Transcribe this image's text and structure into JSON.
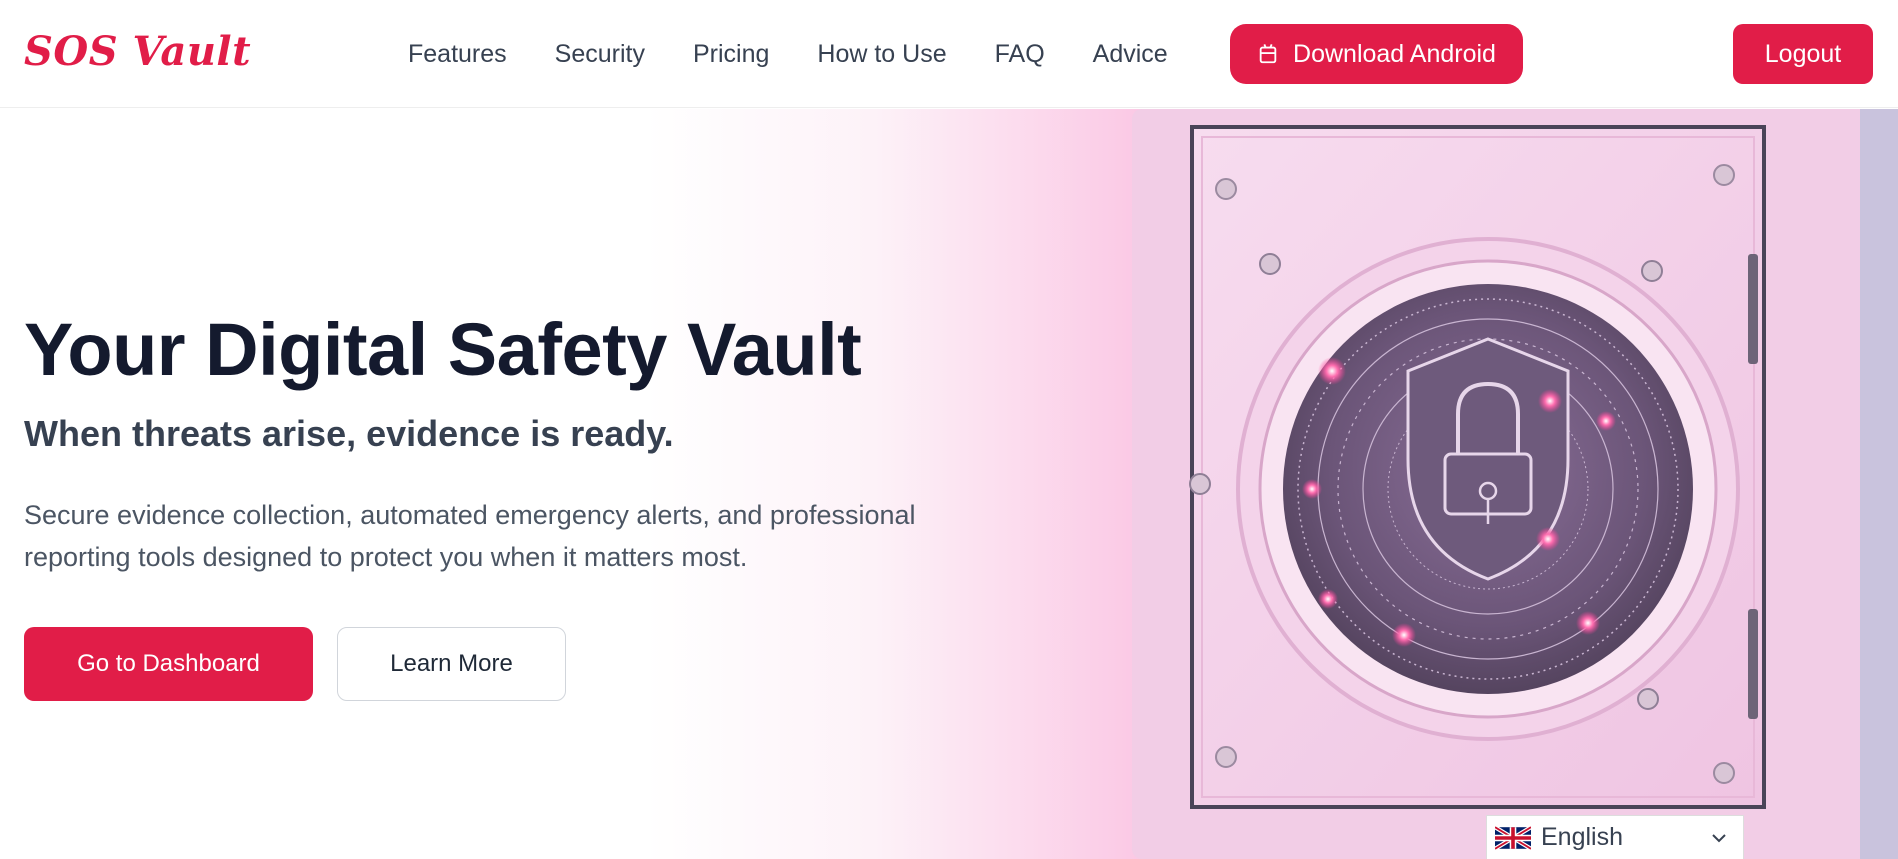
{
  "brand": {
    "logo_text": "SOS Vault",
    "accent_color": "#e11d48"
  },
  "nav": {
    "items": [
      {
        "label": "Features"
      },
      {
        "label": "Security"
      },
      {
        "label": "Pricing"
      },
      {
        "label": "How to Use"
      },
      {
        "label": "FAQ"
      },
      {
        "label": "Advice"
      }
    ],
    "download_android": {
      "label": "Download Android",
      "icon": "android-icon"
    },
    "logout_label": "Logout"
  },
  "hero": {
    "title": "Your Digital Safety Vault",
    "subtitle": "When threats arise, evidence is ready.",
    "description": "Secure evidence collection, automated emergency alerts, and professional reporting tools designed to protect you when it matters most.",
    "primary_button": "Go to Dashboard",
    "secondary_button": "Learn More",
    "image": "vault-safe-illustration"
  },
  "language_selector": {
    "selected": "English",
    "flag": "uk-flag-icon",
    "icon": "chevron-down-icon"
  }
}
